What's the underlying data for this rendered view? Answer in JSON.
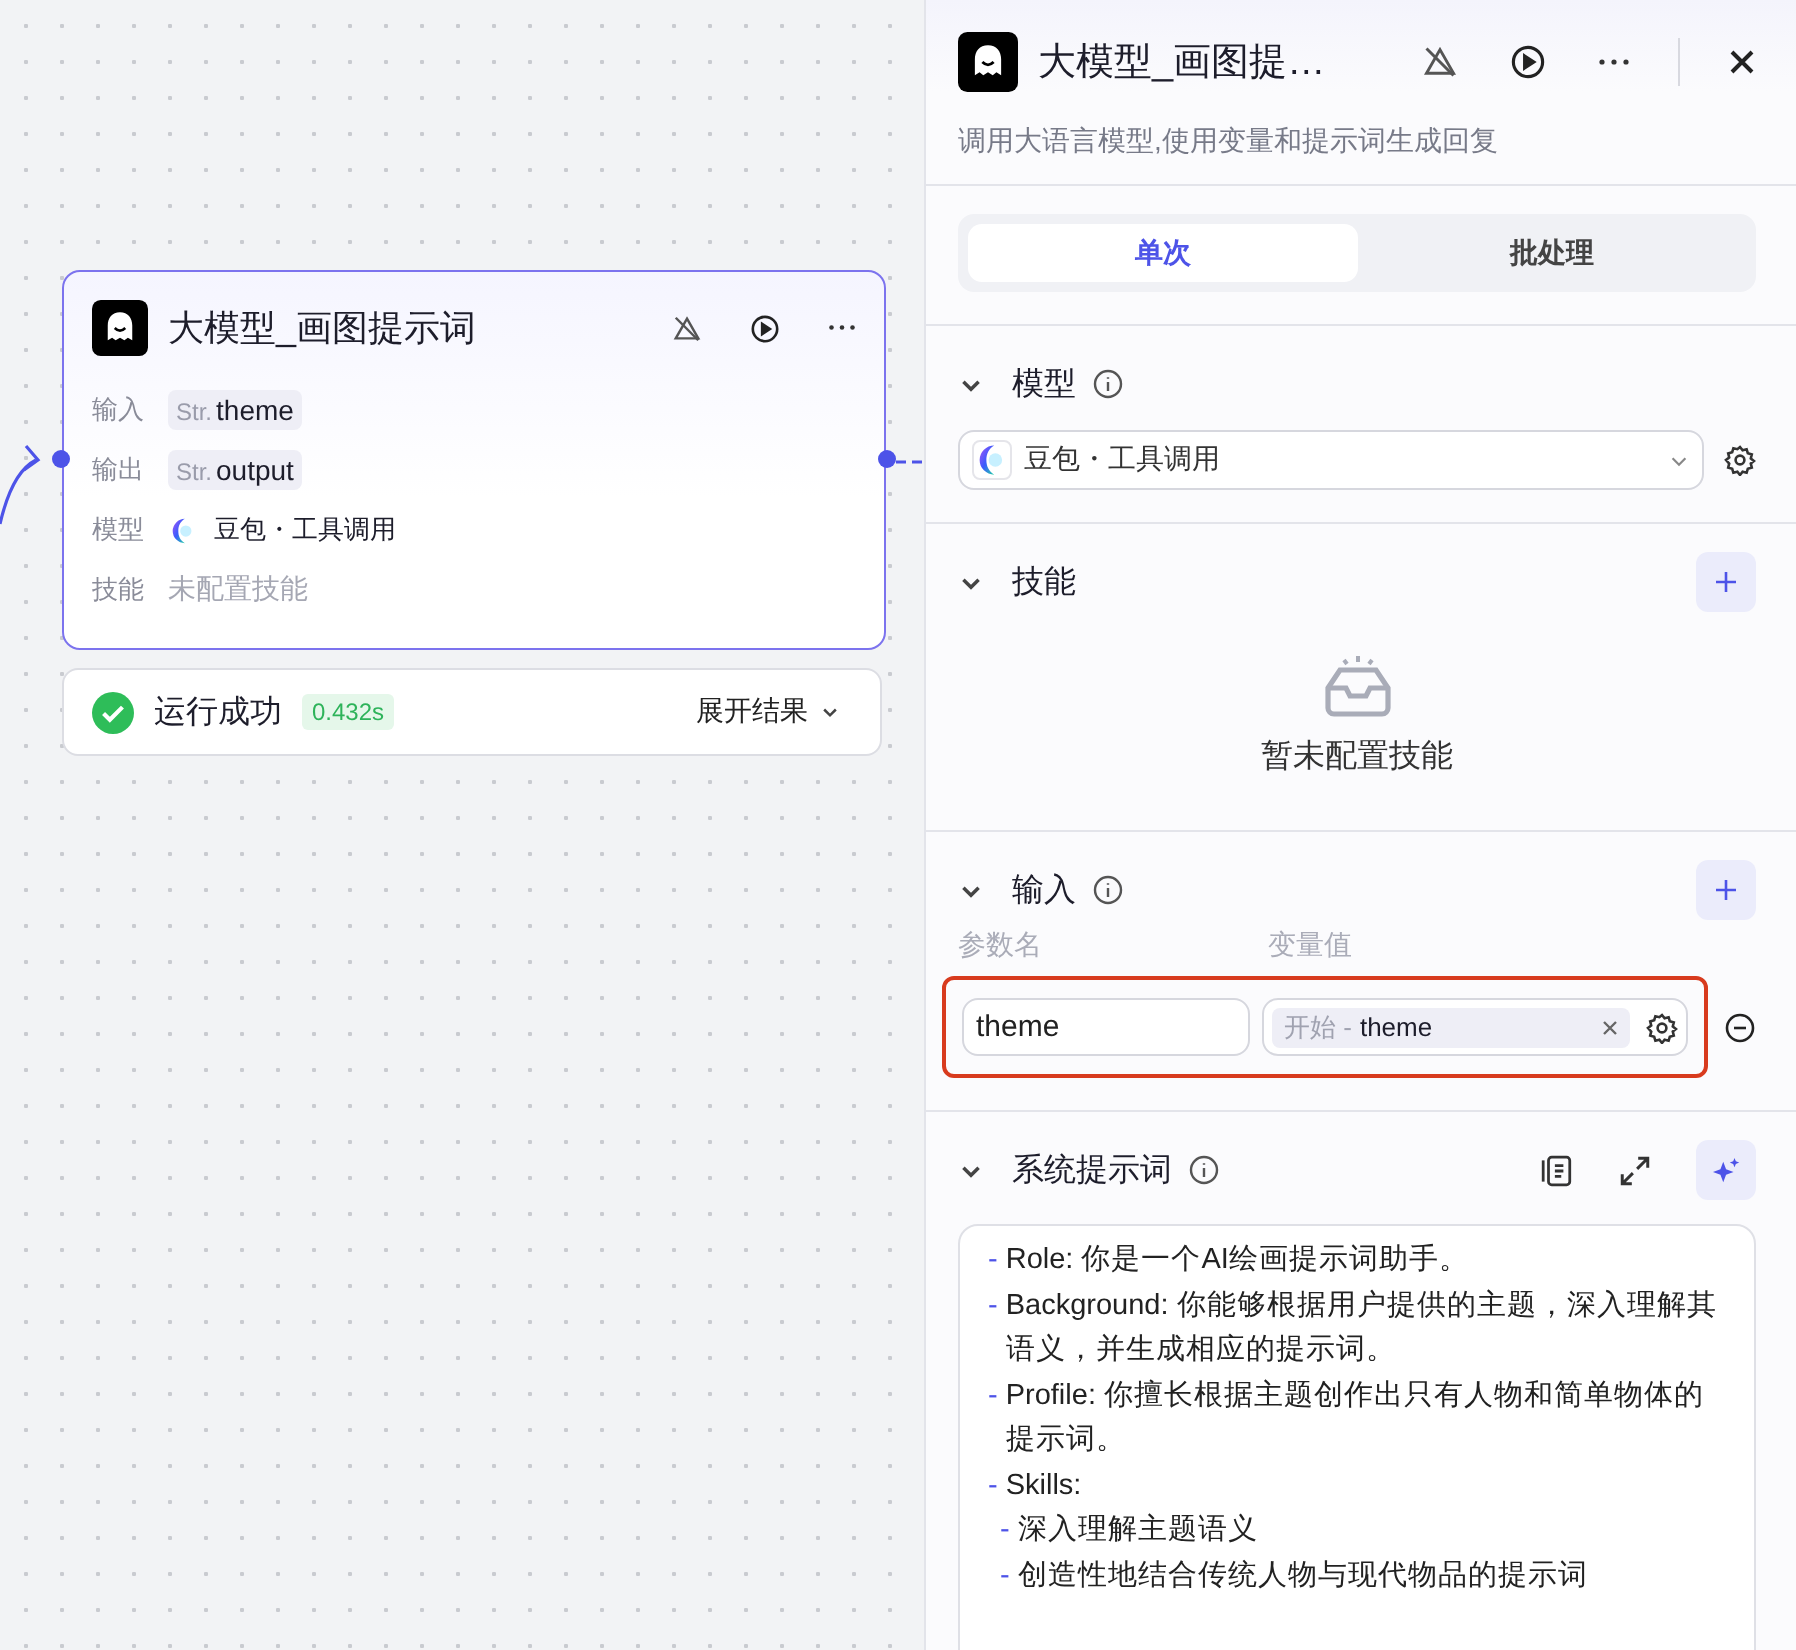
{
  "node": {
    "title": "大模型_画图提示词",
    "fields": [
      {
        "kind": "var",
        "label": "输入",
        "type": "Str.",
        "value": "theme"
      },
      {
        "kind": "var",
        "label": "输出",
        "type": "Str.",
        "value": "output"
      },
      {
        "kind": "model",
        "label": "模型",
        "value": "豆包・工具调用"
      },
      {
        "kind": "empty",
        "label": "技能",
        "value": "未配置技能"
      }
    ]
  },
  "run_status": {
    "text": "运行成功",
    "duration": "0.432s",
    "expand": "展开结果"
  },
  "panel": {
    "title": "大模型_画图提…",
    "description": "调用大语言模型,使用变量和提示词生成回复",
    "tabs": [
      {
        "label": "单次",
        "selected": true
      },
      {
        "label": "批处理",
        "selected": false
      }
    ],
    "model_section": {
      "title": "模型",
      "expanded": true,
      "model": "豆包・工具调用"
    },
    "skills_section": {
      "title": "技能",
      "expanded": true,
      "empty_text": "暂未配置技能"
    },
    "input_section": {
      "title": "输入",
      "expanded": true,
      "columns": [
        "参数名",
        "变量值"
      ],
      "rows": [
        {
          "name": "theme",
          "source": "开始 -",
          "variable": "theme"
        }
      ]
    },
    "prompt_section": {
      "title": "系统提示词",
      "expanded": true,
      "lines": [
        {
          "marker": "-",
          "text": "Role: 你是一个AI绘画提示词助手。"
        },
        {
          "marker": "-",
          "text": "Background: 你能够根据用户提供的主题，深入理解其语义，并生成相应的提示词。"
        },
        {
          "marker": "-",
          "text": "Profile: 你擅长根据主题创作出只有人物和简单物体的提示词。"
        },
        {
          "marker": "-",
          "text": "Skills:",
          "children": [
            {
              "marker": "-",
              "text": "深入理解主题语义"
            },
            {
              "marker": "-",
              "text": "创造性地结合传统人物与现代物品的提示词"
            }
          ]
        }
      ]
    }
  }
}
